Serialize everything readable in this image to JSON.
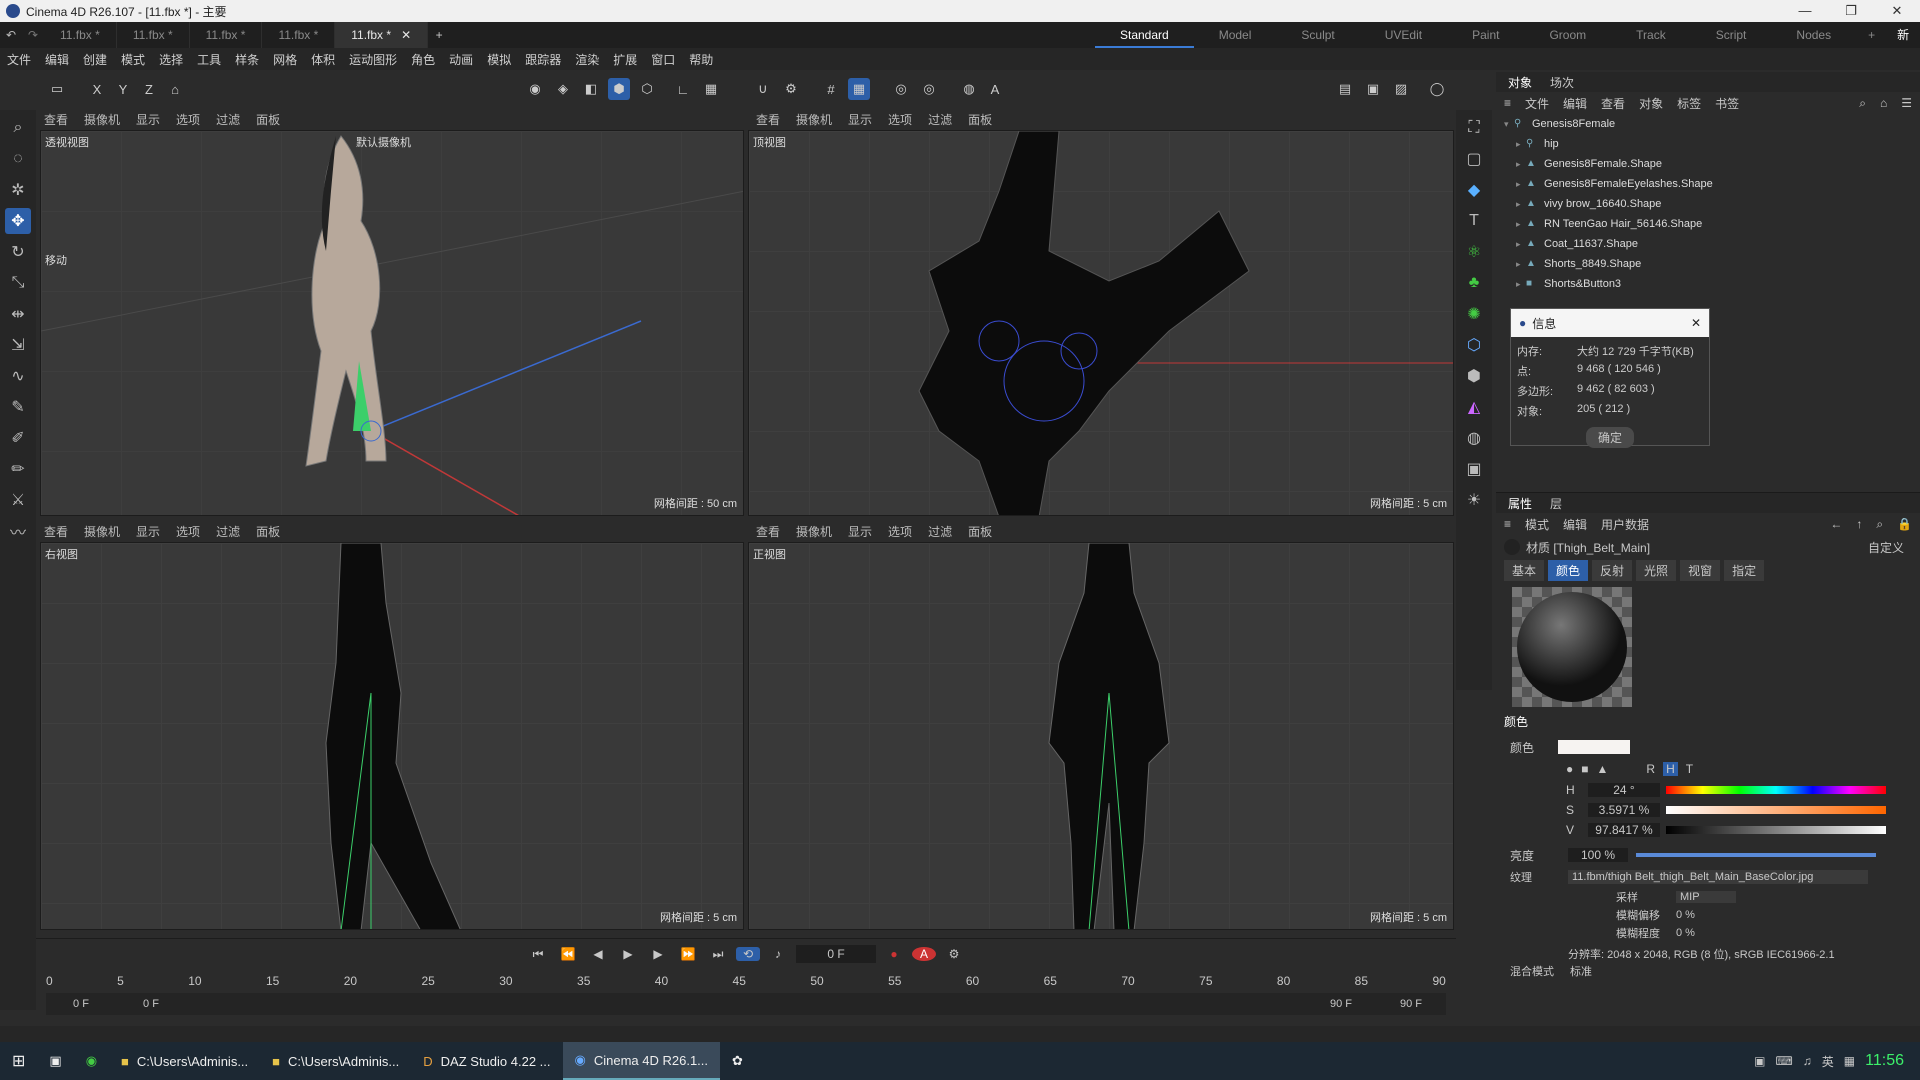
{
  "window": {
    "title": "Cinema 4D R26.107 - [11.fbx *] - 主要"
  },
  "tabs": [
    "11.fbx *",
    "11.fbx *",
    "11.fbx *",
    "11.fbx *",
    "11.fbx *"
  ],
  "layouts": [
    "Standard",
    "Model",
    "Sculpt",
    "UVEdit",
    "Paint",
    "Groom",
    "Track",
    "Script",
    "Nodes",
    "+",
    "新界面"
  ],
  "menu": [
    "文件",
    "编辑",
    "创建",
    "模式",
    "选择",
    "工具",
    "样条",
    "网格",
    "体积",
    "运动图形",
    "角色",
    "动画",
    "模拟",
    "跟踪器",
    "渲染",
    "扩展",
    "窗口",
    "帮助"
  ],
  "viewport_menu": [
    "查看",
    "摄像机",
    "显示",
    "选项",
    "过滤",
    "面板"
  ],
  "viewports": {
    "persp": {
      "label": "透视视图",
      "camera": "默认摄像机",
      "grid": "网格间距 : 50 cm",
      "move": "移动"
    },
    "top": {
      "label": "顶视图",
      "grid": "网格间距 : 5 cm"
    },
    "right": {
      "label": "右视图",
      "grid": "网格间距 : 5 cm"
    },
    "front": {
      "label": "正视图",
      "grid": "网格间距 : 5 cm"
    }
  },
  "timeline": {
    "frame": "0 F",
    "ticks": [
      "0",
      "5",
      "10",
      "15",
      "20",
      "25",
      "30",
      "35",
      "40",
      "45",
      "50",
      "55",
      "60",
      "65",
      "70",
      "75",
      "80",
      "85",
      "90"
    ],
    "start": "0 F",
    "start2": "0 F",
    "end": "90 F",
    "end2": "90 F"
  },
  "objects": {
    "tabs": [
      "对象",
      "场次"
    ],
    "menu": [
      "文件",
      "编辑",
      "查看",
      "对象",
      "标签",
      "书签"
    ],
    "items": [
      "Genesis8Female",
      "hip",
      "Genesis8Female.Shape",
      "Genesis8FemaleEyelashes.Shape",
      "vivy brow_16640.Shape",
      "RN TeenGao Hair_56146.Shape",
      "Coat_11637.Shape",
      "Shorts_8849.Shape",
      "Shorts&Button3"
    ]
  },
  "info_dialog": {
    "title": "信息",
    "rows": [
      [
        "内存:",
        "大约 12 729 千字节(KB)"
      ],
      [
        "点:",
        "9 468 ( 120 546 )"
      ],
      [
        "多边形:",
        "9 462 ( 82 603 )"
      ],
      [
        "对象:",
        "205 ( 212 )"
      ]
    ],
    "ok": "确定"
  },
  "attributes": {
    "tabs": [
      "属性",
      "层"
    ],
    "menu": [
      "模式",
      "编辑",
      "用户数据"
    ],
    "material": "材质 [Thigh_Belt_Main]",
    "preset": "自定义",
    "subtabs": [
      "基本",
      "颜色",
      "反射",
      "光照",
      "视窗",
      "指定"
    ],
    "section": "颜色",
    "color_label": "颜色",
    "hsv": {
      "H": "24 °",
      "S": "3.5971 %",
      "V": "97.8417 %"
    },
    "brightness_label": "亮度",
    "brightness": "100 %",
    "texture_label": "纹理",
    "texture": "11.fbm/thigh Belt_thigh_Belt_Main_BaseColor.jpg",
    "sampling_label": "采样",
    "sampling": "MIP",
    "blur_offset_label": "模糊偏移",
    "blur_offset": "0 %",
    "blur_scale_label": "模糊程度",
    "blur_scale": "0 %",
    "resolution": "分辨率: 2048 x 2048, RGB (8 位), sRGB IEC61966-2.1",
    "blend_label": "混合模式",
    "blend": "标准"
  },
  "taskbar": {
    "items": [
      "C:\\Users\\Adminis...",
      "C:\\Users\\Adminis...",
      "DAZ Studio 4.22 ...",
      "Cinema 4D R26.1..."
    ],
    "time": "11:56",
    "ime": "英"
  },
  "colors": {
    "accent": "#2d5fa8",
    "bg": "#2b2b2b",
    "viewport": "#393939"
  }
}
